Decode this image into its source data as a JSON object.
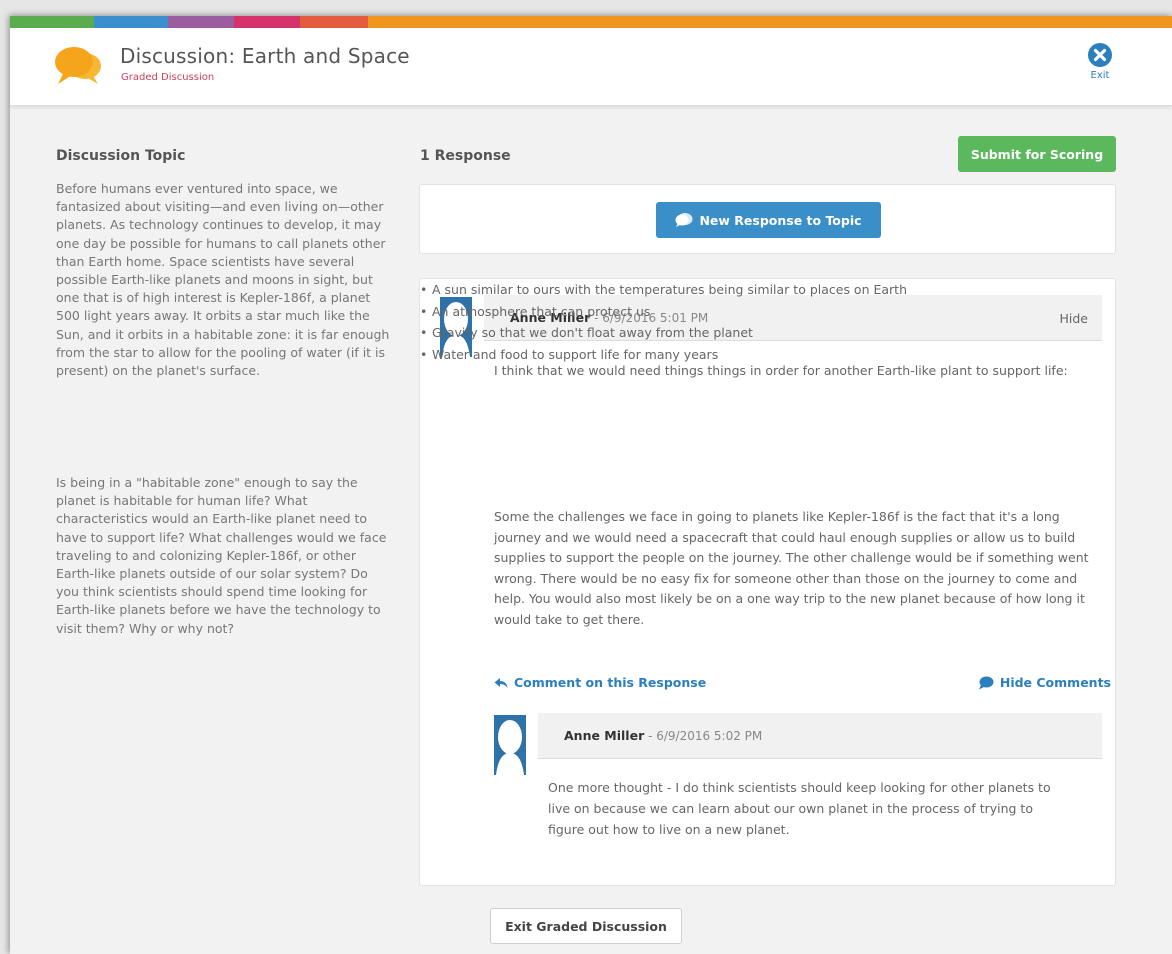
{
  "header": {
    "title": "Discussion: Earth and Space",
    "subtitle": "Graded Discussion",
    "exit_label": "Exit",
    "logo_icon": "chat-bubbles-icon",
    "colors": {
      "stripes": [
        "#5aac4e",
        "#3b8fcf",
        "#9b5d9e",
        "#d6336c",
        "#e55b3f",
        "#f0961f"
      ],
      "logo_orange": "#f4a51c",
      "exit_blue": "#2b7fbf"
    }
  },
  "topic": {
    "heading": "Discussion Topic",
    "paragraph_1": "Before humans ever ventured into space, we fantasized about visiting—and even living on—other planets. As technology continues to develop, it may one day be possible for humans to call planets other than Earth home. Space scientists have several possible Earth-like planets and moons in sight, but one that is of high interest is Kepler-186f, a planet 500 light years away. It orbits a star much like the Sun, and it orbits in a habitable zone: it is far enough from the star to allow for the pooling of water (if it is present) on the planet's surface.",
    "paragraph_2": "Is being in a \"habitable zone\" enough to say the planet is habitable for human life? What characteristics would an Earth-like planet need to have to support life? What challenges would we face traveling to and colonizing Kepler-186f, or other Earth-like planets outside of our solar system? Do you think scientists should spend time looking for Earth-like planets before we have the technology to visit them? Why or why not?"
  },
  "responses": {
    "count_label": "1 Response",
    "submit_label": "Submit for Scoring",
    "new_response_label": "New Response to Topic"
  },
  "post": {
    "author": "Anne Miller",
    "date": " - 6/9/2016 5:01 PM",
    "hide_label": "Hide",
    "intro": "I think that we would need things things in order for another Earth-like plant to support life:",
    "bullets": [
      "A sun similar to ours with the temperatures being similar to places on Earth",
      "An atmosphere that can protect us",
      "Gravity so that we don't float away from the planet",
      "Water and food to support life for many years"
    ],
    "body": "Some the challenges we face in going to planets like Kepler-186f is the fact that it's a long journey and we would need a spacecraft that could haul enough supplies or allow us to build supplies to support the people on the journey.  The other challenge would be if something went wrong.  There would be no easy fix for someone other than those on the journey to come and help. You would also most likely be on a one way trip to the new planet because of how long it would take to get there.",
    "comment_label": "Comment on this Response",
    "hide_comments_label": "Hide Comments"
  },
  "comment": {
    "author": "Anne Miller",
    "date": " - 6/9/2016 5:02 PM",
    "text": "One more thought - I do think scientists should keep looking for other planets to live on because we can learn about our own planet in the process of trying to figure out how to live on a new planet."
  },
  "footer": {
    "exit_discussion_label": "Exit Graded Discussion"
  }
}
